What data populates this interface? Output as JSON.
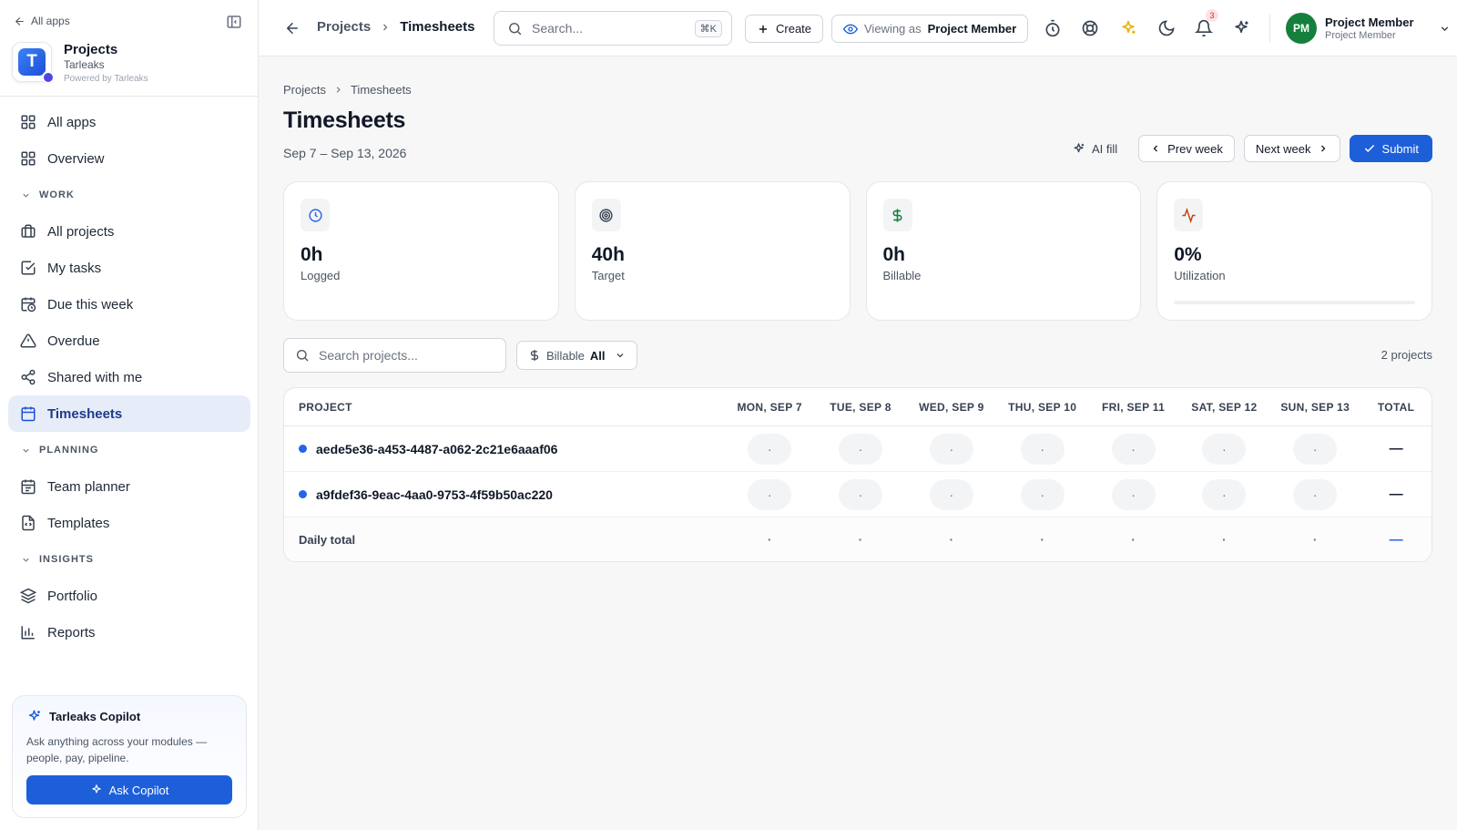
{
  "sidebar": {
    "back_label": "All apps",
    "brand": {
      "name": "Projects",
      "org": "Tarleaks",
      "powered": "Powered by Tarleaks",
      "logo_letter": "T"
    },
    "items_top": [
      {
        "label": "All apps",
        "icon": "grid-icon"
      },
      {
        "label": "Overview",
        "icon": "grid-icon"
      }
    ],
    "sections": [
      {
        "title": "WORK",
        "items": [
          {
            "label": "All projects",
            "icon": "briefcase-icon"
          },
          {
            "label": "My tasks",
            "icon": "checkbox-icon"
          },
          {
            "label": "Due this week",
            "icon": "calendar-clock-icon"
          },
          {
            "label": "Overdue",
            "icon": "warning-icon"
          },
          {
            "label": "Shared with me",
            "icon": "share-icon"
          },
          {
            "label": "Timesheets",
            "icon": "calendar-icon",
            "active": true
          }
        ]
      },
      {
        "title": "PLANNING",
        "items": [
          {
            "label": "Team planner",
            "icon": "calendar-icon"
          },
          {
            "label": "Templates",
            "icon": "file-code-icon"
          }
        ]
      },
      {
        "title": "INSIGHTS",
        "items": [
          {
            "label": "Portfolio",
            "icon": "layers-icon"
          },
          {
            "label": "Reports",
            "icon": "bar-chart-icon"
          }
        ]
      }
    ],
    "copilot": {
      "title": "Tarleaks Copilot",
      "desc": "Ask anything across your modules — people, pay, pipeline.",
      "button": "Ask Copilot"
    }
  },
  "topbar": {
    "breadcrumb": [
      "Projects",
      "Timesheets"
    ],
    "search_placeholder": "Search...",
    "search_shortcut": "⌘K",
    "create_label": "Create",
    "viewing_as_prefix": "Viewing as",
    "viewing_as_role": "Project Member",
    "notification_count": "3",
    "user": {
      "initials": "PM",
      "name": "Project Member",
      "role": "Project Member"
    }
  },
  "page": {
    "breadcrumb": [
      "Projects",
      "Timesheets"
    ],
    "title": "Timesheets",
    "date_range": "Sep 7 – Sep 13, 2026",
    "actions": {
      "ai_fill": "AI fill",
      "prev": "Prev week",
      "next": "Next week",
      "submit": "Submit"
    }
  },
  "stats": [
    {
      "value": "0h",
      "label": "Logged",
      "icon": "clock-icon",
      "color": "#2563eb"
    },
    {
      "value": "40h",
      "label": "Target",
      "icon": "target-icon",
      "color": "#374151"
    },
    {
      "value": "0h",
      "label": "Billable",
      "icon": "dollar-icon",
      "color": "#15803d"
    },
    {
      "value": "0%",
      "label": "Utilization",
      "icon": "activity-icon",
      "color": "#c2410c",
      "progress": 0
    }
  ],
  "filters": {
    "search_placeholder": "Search projects...",
    "billable_label": "Billable",
    "billable_value": "All",
    "count": "2 projects"
  },
  "table": {
    "project_header": "PROJECT",
    "days": [
      "MON, SEP 7",
      "TUE, SEP 8",
      "WED, SEP 9",
      "THU, SEP 10",
      "FRI, SEP 11",
      "SAT, SEP 12",
      "SUN, SEP 13"
    ],
    "total_header": "TOTAL",
    "rows": [
      {
        "name": "aede5e36-a453-4487-a062-2c21e6aaaf06",
        "cells": [
          "·",
          "·",
          "·",
          "·",
          "·",
          "·",
          "·"
        ],
        "total": "—"
      },
      {
        "name": "a9fdef36-9eac-4aa0-9753-4f59b50ac220",
        "cells": [
          "·",
          "·",
          "·",
          "·",
          "·",
          "·",
          "·"
        ],
        "total": "—"
      }
    ],
    "footer_label": "Daily total",
    "footer_cells": [
      "·",
      "·",
      "·",
      "·",
      "·",
      "·",
      "·"
    ],
    "footer_total": "—"
  }
}
